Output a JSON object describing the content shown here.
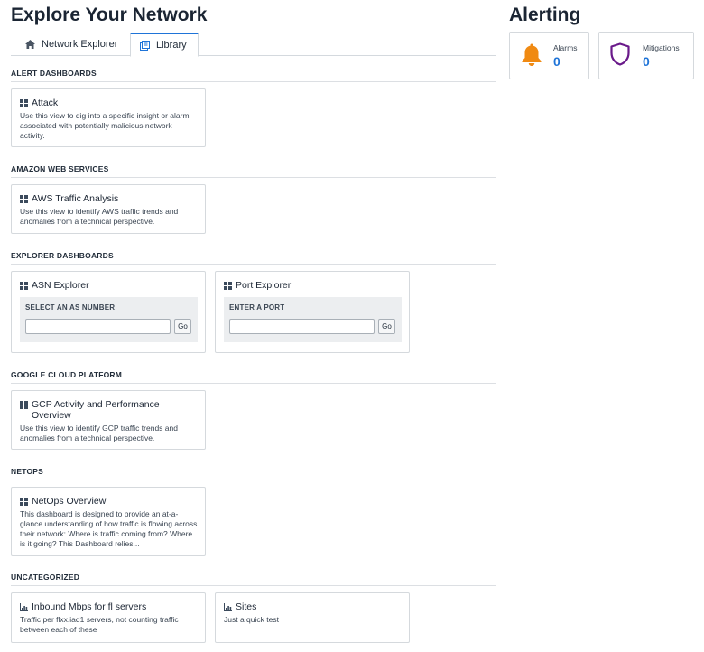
{
  "page_title": "Explore Your Network",
  "tabs": [
    {
      "label": "Network Explorer",
      "icon": "home-icon"
    },
    {
      "label": "Library",
      "icon": "library-icon",
      "active": true
    }
  ],
  "sections": {
    "alert": {
      "title": "ALERT DASHBOARDS",
      "cards": [
        {
          "title": "Attack",
          "desc": "Use this view to dig into a specific insight or alarm associated with potentially malicious network activity."
        }
      ]
    },
    "aws": {
      "title": "AMAZON WEB SERVICES",
      "cards": [
        {
          "title": "AWS Traffic Analysis",
          "desc": "Use this view to identify AWS traffic trends and anomalies from a technical perspective."
        }
      ]
    },
    "explorer": {
      "title": "EXPLORER DASHBOARDS",
      "cards": [
        {
          "title": "ASN Explorer",
          "field_label": "SELECT AN AS NUMBER",
          "input_value": "",
          "go_label": "Go"
        },
        {
          "title": "Port Explorer",
          "field_label": "ENTER A PORT",
          "input_value": "",
          "go_label": "Go"
        }
      ]
    },
    "gcp": {
      "title": "GOOGLE CLOUD PLATFORM",
      "cards": [
        {
          "title": "GCP Activity and Performance Overview",
          "desc": "Use this view to identify GCP traffic trends and anomalies from a technical perspective."
        }
      ]
    },
    "netops": {
      "title": "NETOPS",
      "cards": [
        {
          "title": "NetOps Overview",
          "desc": "This dashboard is designed to provide an at-a-glance understanding of how traffic is flowing across their network: Where is traffic coming from? Where is it going? This Dashboard relies..."
        }
      ]
    },
    "uncategorized": {
      "title": "UNCATEGORIZED",
      "cards": [
        {
          "title": "Inbound Mbps for fl servers",
          "desc": "Traffic per flxx.iad1 servers, not counting traffic between each of these"
        },
        {
          "title": "Sites",
          "desc": "Just a quick test"
        }
      ]
    }
  },
  "alerting": {
    "title": "Alerting",
    "alarms": {
      "label": "Alarms",
      "value": "0",
      "icon": "bell-icon",
      "color": "#f08a12"
    },
    "mitigations": {
      "label": "Mitigations",
      "value": "0",
      "icon": "shield-icon",
      "color": "#6a1a8a"
    }
  },
  "colors": {
    "accent": "#1f74d8",
    "text": "#1b2533",
    "border": "#d5d9dd"
  }
}
